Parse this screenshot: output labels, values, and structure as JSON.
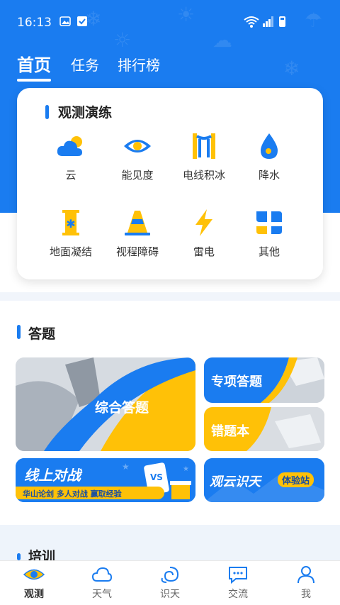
{
  "status": {
    "time": "16:13"
  },
  "tabs": [
    "首页",
    "任务",
    "排行榜"
  ],
  "observe": {
    "title": "观测演练",
    "items": [
      {
        "label": "云",
        "icon": "cloud-sun-icon"
      },
      {
        "label": "能见度",
        "icon": "eye-icon"
      },
      {
        "label": "电线积冰",
        "icon": "wire-ice-icon"
      },
      {
        "label": "降水",
        "icon": "drop-icon"
      },
      {
        "label": "地面凝结",
        "icon": "frost-icon"
      },
      {
        "label": "视程障碍",
        "icon": "cone-icon"
      },
      {
        "label": "雷电",
        "icon": "lightning-icon"
      },
      {
        "label": "其他",
        "icon": "more-icon"
      }
    ]
  },
  "quiz": {
    "title": "答题",
    "comprehensive": "综合答题",
    "special": "专项答题",
    "mistakes": "错题本",
    "battle": {
      "title": "线上对战",
      "subtitle": "华山论剑 多人对战 赢取经验",
      "vs": "VS"
    },
    "cloud": {
      "title": "观云识天",
      "badge": "体验站"
    }
  },
  "training": {
    "title": "培训"
  },
  "nav": [
    {
      "label": "观测",
      "icon": "eye-icon",
      "active": true
    },
    {
      "label": "天气",
      "icon": "cloud-icon",
      "active": false
    },
    {
      "label": "识天",
      "icon": "swirl-icon",
      "active": false
    },
    {
      "label": "交流",
      "icon": "chat-icon",
      "active": false
    },
    {
      "label": "我",
      "icon": "person-icon",
      "active": false
    }
  ],
  "colors": {
    "primary": "#1a7cf0",
    "accent": "#ffc107"
  }
}
